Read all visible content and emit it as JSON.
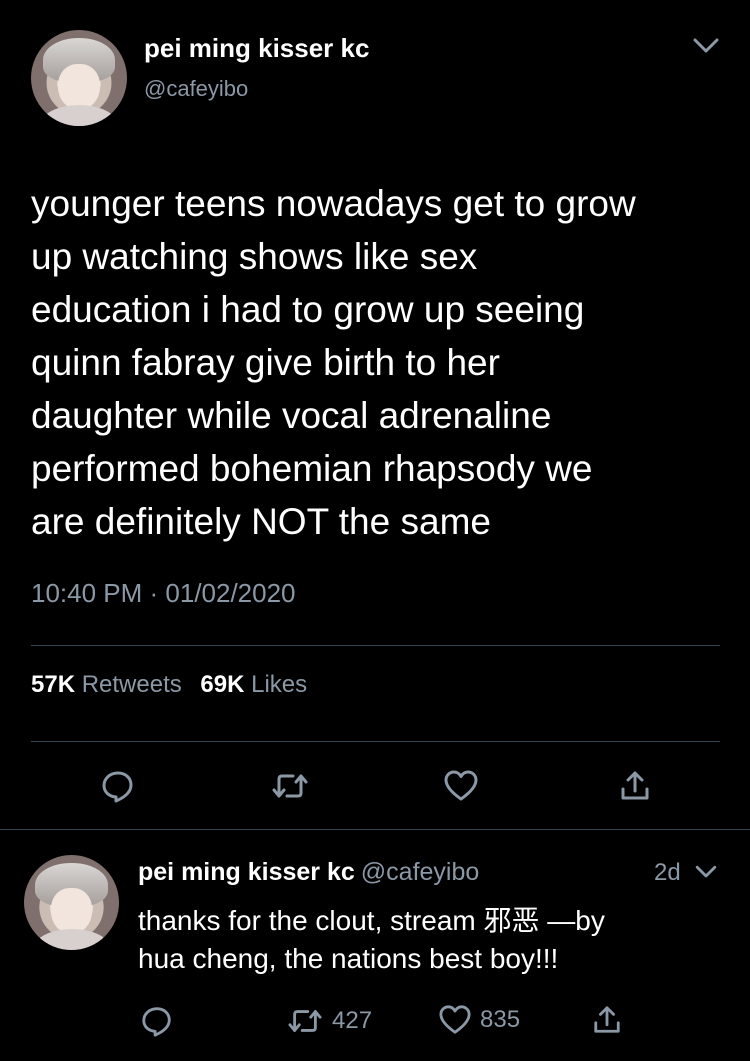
{
  "tweet": {
    "display_name": "pei ming kisser kc",
    "handle": "@cafeyibo",
    "text": "younger teens nowadays get to grow\nup watching shows like sex\neducation i had to grow up seeing\nquinn fabray give birth to her\ndaughter while vocal adrenaline\nperformed bohemian rhapsody we\nare definitely NOT the same",
    "timestamp": "10:40 PM · 01/02/2020",
    "retweets_count": "57K",
    "retweets_label": "Retweets",
    "likes_count": "69K",
    "likes_label": "Likes",
    "icons": {
      "menu": "chevron-down-icon",
      "reply": "reply-icon",
      "retweet": "retweet-icon",
      "like": "heart-icon",
      "share": "share-icon"
    }
  },
  "reply": {
    "display_name": "pei ming kisser kc",
    "handle": "@cafeyibo",
    "time": "2d",
    "text": "thanks for the clout, stream 邪恶 —by\nhua cheng, the nations best boy!!!",
    "retweets_count": "427",
    "likes_count": "835"
  },
  "colors": {
    "background": "#000000",
    "text": "#ffffff",
    "secondary": "#8b98a5",
    "divider": "#38444d"
  }
}
